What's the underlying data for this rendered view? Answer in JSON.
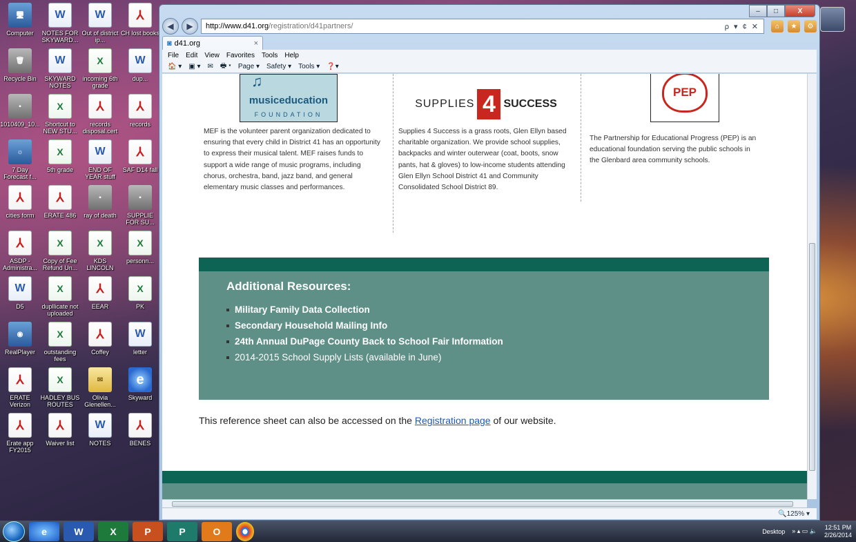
{
  "desktop": {
    "icons": [
      {
        "label": "Computer",
        "type": "sys",
        "glyph": "🖥"
      },
      {
        "label": "NOTES FOR SKYWARD...",
        "type": "word",
        "glyph": "W"
      },
      {
        "label": "Out of district ip...",
        "type": "word",
        "glyph": "W"
      },
      {
        "label": "CH lost books",
        "type": "pdf",
        "glyph": "⅄"
      },
      {
        "label": "Recycle Bin",
        "type": "other",
        "glyph": "🗑"
      },
      {
        "label": "SKYWARD NOTES",
        "type": "word",
        "glyph": "W"
      },
      {
        "label": "incoming 6th grade",
        "type": "excel",
        "glyph": "X"
      },
      {
        "label": "dup...",
        "type": "word",
        "glyph": "W"
      },
      {
        "label": "1010409_10...",
        "type": "other",
        "glyph": "▪"
      },
      {
        "label": "Shortcut to NEW STU...",
        "type": "excel",
        "glyph": "X"
      },
      {
        "label": "records disposal.cert",
        "type": "pdf",
        "glyph": "⅄"
      },
      {
        "label": "records",
        "type": "pdf",
        "glyph": "⅄"
      },
      {
        "label": "7 Day Forecast f...",
        "type": "sys",
        "glyph": "☼"
      },
      {
        "label": "5th grade",
        "type": "excel",
        "glyph": "X"
      },
      {
        "label": "END OF YEAR stuff",
        "type": "word",
        "glyph": "W"
      },
      {
        "label": "SAF D14 fall",
        "type": "pdf",
        "glyph": "⅄"
      },
      {
        "label": "cities form",
        "type": "pdf",
        "glyph": "⅄"
      },
      {
        "label": "ERATE 486",
        "type": "pdf",
        "glyph": "⅄"
      },
      {
        "label": "ray of death",
        "type": "other",
        "glyph": "▪"
      },
      {
        "label": "SUPPLIE FOR SU...",
        "type": "other",
        "glyph": "▪"
      },
      {
        "label": "ASDP - Administra...",
        "type": "pdf",
        "glyph": "⅄"
      },
      {
        "label": "Copy of Fee Refund Un...",
        "type": "excel",
        "glyph": "X"
      },
      {
        "label": "KDS LINCOLN",
        "type": "excel",
        "glyph": "X"
      },
      {
        "label": "personn...",
        "type": "excel",
        "glyph": "X"
      },
      {
        "label": "D5",
        "type": "word",
        "glyph": "W"
      },
      {
        "label": "dupllicate not uploaded",
        "type": "excel",
        "glyph": "X"
      },
      {
        "label": "EEAR",
        "type": "pdf",
        "glyph": "⅄"
      },
      {
        "label": "PK",
        "type": "excel",
        "glyph": "X"
      },
      {
        "label": "RealPlayer",
        "type": "sys",
        "glyph": "◉"
      },
      {
        "label": "outstanding fees",
        "type": "excel",
        "glyph": "X"
      },
      {
        "label": "Coffey",
        "type": "pdf",
        "glyph": "⅄"
      },
      {
        "label": "letter",
        "type": "word",
        "glyph": "W"
      },
      {
        "label": "ERATE Verizon",
        "type": "pdf",
        "glyph": "⅄"
      },
      {
        "label": "HADLEY BUS ROUTES",
        "type": "excel",
        "glyph": "X"
      },
      {
        "label": "Olivia Glenellen...",
        "type": "mail",
        "glyph": "✉"
      },
      {
        "label": "Skyward",
        "type": "ie",
        "glyph": "e"
      },
      {
        "label": "Erate app FY2015",
        "type": "pdf",
        "glyph": "⅄"
      },
      {
        "label": "Waiver list",
        "type": "pdf",
        "glyph": "⅄"
      },
      {
        "label": "NOTES",
        "type": "word",
        "glyph": "W"
      },
      {
        "label": "BENES",
        "type": "pdf",
        "glyph": "⅄"
      }
    ]
  },
  "browser": {
    "url_host": "http://www.d41.org",
    "url_path": "/registration/d41partners/",
    "address_tools": "ρ ▾ ¢ ✕",
    "tab_title": "d41.org",
    "tab_close": "×",
    "menu": [
      "File",
      "Edit",
      "View",
      "Favorites",
      "Tools",
      "Help"
    ],
    "commands": [
      "🏠 ▾",
      "▣ ▾",
      "✉",
      "🖶 ▾",
      "Page ▾",
      "Safety ▾",
      "Tools ▾",
      "❓▾"
    ],
    "zoom": "🔍125%  ▾",
    "window_controls": {
      "minimize": "–",
      "maximize": "□",
      "close": "X"
    }
  },
  "partners": [
    {
      "logo": {
        "title": "musiceducation",
        "sub": "FOUNDATION",
        "mark": "♫"
      },
      "text": "MEF is the volunteer parent organization dedicated to ensuring that every child in District 41 has an opportunity to express their musical talent. MEF raises funds to support a wide range of music programs, including chorus, orchestra, band, jazz band, and general elementary music classes and performances."
    },
    {
      "logo": {
        "left": "SUPPLIES",
        "mid": "4",
        "right": "SUCCESS"
      },
      "text": "Supplies 4 Success is a grass roots, Glen Ellyn based charitable organization. We provide school supplies, backpacks and winter outerwear (coat, boots, snow pants, hat & gloves) to low-income students attending Glen Ellyn School District 41 and Community Consolidated School District 89."
    },
    {
      "logo": {
        "title": "PEP"
      },
      "text": "The Partnership for Educational Progress (PEP) is an educational foundation serving the public schools in the Glenbard area community schools."
    }
  ],
  "resources": {
    "title": "Additional Resources:",
    "items": [
      {
        "text": "Military Family Data Collection",
        "bold": true
      },
      {
        "text": "Secondary Household Mailing Info",
        "bold": true
      },
      {
        "text": "24th Annual DuPage County Back to School Fair Information",
        "bold": true
      },
      {
        "text": "2014-2015 School Supply Lists (available in June)",
        "bold": false
      }
    ]
  },
  "reference": {
    "before": "This reference sheet can also be accessed on the ",
    "link": "Registration page",
    "after": " of our website."
  },
  "taskbar": {
    "apps": [
      {
        "name": "ie",
        "glyph": "e"
      },
      {
        "name": "word",
        "glyph": "W"
      },
      {
        "name": "excel",
        "glyph": "X"
      },
      {
        "name": "ppt",
        "glyph": "P"
      },
      {
        "name": "pub",
        "glyph": "P"
      },
      {
        "name": "outlook",
        "glyph": "O"
      },
      {
        "name": "chrome",
        "glyph": ""
      }
    ],
    "desktop_label": "Desktop",
    "time": "12:51 PM",
    "date": "2/26/2014"
  }
}
